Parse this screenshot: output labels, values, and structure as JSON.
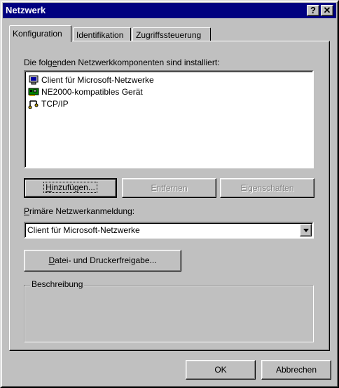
{
  "window": {
    "title": "Netzwerk",
    "help_label": "?",
    "close_label": "✕"
  },
  "tabs": [
    {
      "label": "Konfiguration",
      "active": true
    },
    {
      "label": "Identifikation",
      "active": false
    },
    {
      "label": "Zugriffssteuerung",
      "active": false
    }
  ],
  "components": {
    "heading_pre": "Die folg",
    "heading_key": "e",
    "heading_post": "nden Netzwerkkomponenten sind installiert:",
    "items": [
      {
        "label": "Client für Microsoft-Netzwerke",
        "icon": "client-icon"
      },
      {
        "label": "NE2000-kompatibles Gerät",
        "icon": "network-card-icon"
      },
      {
        "label": "TCP/IP",
        "icon": "protocol-icon"
      }
    ]
  },
  "buttons": {
    "add_key": "H",
    "add_rest": "inzufügen...",
    "remove_label": "Entfernen",
    "properties_label": "Eigenschaften",
    "share_key": "D",
    "share_rest": "atei- und Druckerfreigabe...",
    "ok_label": "OK",
    "cancel_label": "Abbrechen"
  },
  "logon": {
    "label_key": "P",
    "label_rest": "rimäre Netzwerkanmeldung:",
    "value": "Client für Microsoft-Netzwerke"
  },
  "description": {
    "group_label": "Beschreibung"
  }
}
